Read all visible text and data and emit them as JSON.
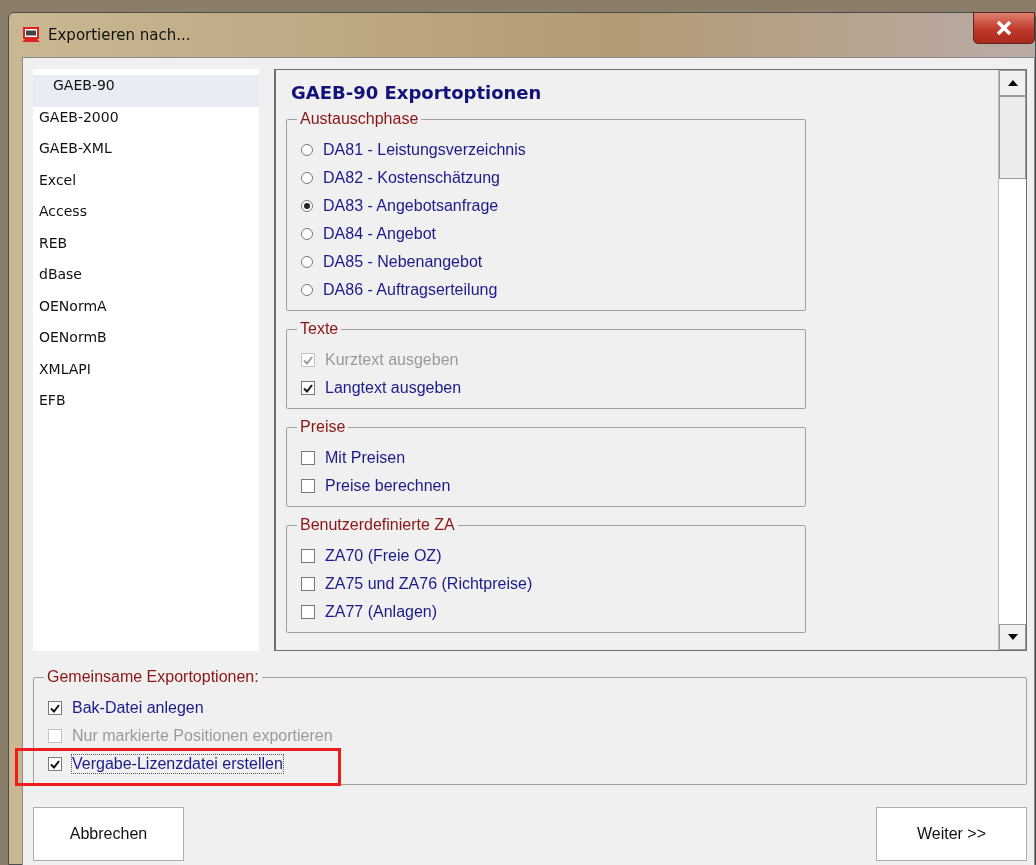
{
  "window": {
    "title": "Exportieren nach..."
  },
  "formats": [
    {
      "label": "GAEB-90",
      "selected": true
    },
    {
      "label": "GAEB-2000",
      "selected": false
    },
    {
      "label": "GAEB-XML",
      "selected": false
    },
    {
      "label": "Excel",
      "selected": false
    },
    {
      "label": "Access",
      "selected": false
    },
    {
      "label": "REB",
      "selected": false
    },
    {
      "label": "dBase",
      "selected": false
    },
    {
      "label": "OENormA",
      "selected": false
    },
    {
      "label": "OENormB",
      "selected": false
    },
    {
      "label": "XMLAPI",
      "selected": false
    },
    {
      "label": "EFB",
      "selected": false
    }
  ],
  "options_panel": {
    "heading": "GAEB-90 Exportoptionen",
    "groups": [
      {
        "title": "Austauschphase",
        "options": [
          {
            "kind": "radio",
            "label": "DA81 - Leistungsverzeichnis",
            "selected": false,
            "disabled": false
          },
          {
            "kind": "radio",
            "label": "DA82 - Kostenschätzung",
            "selected": false,
            "disabled": false
          },
          {
            "kind": "radio",
            "label": "DA83 - Angebotsanfrage",
            "selected": true,
            "disabled": false
          },
          {
            "kind": "radio",
            "label": "DA84 - Angebot",
            "selected": false,
            "disabled": false
          },
          {
            "kind": "radio",
            "label": "DA85 - Nebenangebot",
            "selected": false,
            "disabled": false
          },
          {
            "kind": "radio",
            "label": "DA86 - Auftragserteilung",
            "selected": false,
            "disabled": false
          }
        ]
      },
      {
        "title": "Texte",
        "options": [
          {
            "kind": "checkbox",
            "label": "Kurztext ausgeben",
            "checked": true,
            "disabled": true
          },
          {
            "kind": "checkbox",
            "label": "Langtext ausgeben",
            "checked": true,
            "disabled": false
          }
        ]
      },
      {
        "title": "Preise",
        "options": [
          {
            "kind": "checkbox",
            "label": "Mit Preisen",
            "checked": false,
            "disabled": false
          },
          {
            "kind": "checkbox",
            "label": "Preise berechnen",
            "checked": false,
            "disabled": false
          }
        ]
      },
      {
        "title": "Benutzerdefinierte ZA",
        "options": [
          {
            "kind": "checkbox",
            "label": "ZA70 (Freie OZ)",
            "checked": false,
            "disabled": false
          },
          {
            "kind": "checkbox",
            "label": "ZA75 und ZA76 (Richtpreise)",
            "checked": false,
            "disabled": false
          },
          {
            "kind": "checkbox",
            "label": "ZA77 (Anlagen)",
            "checked": false,
            "disabled": false
          }
        ]
      }
    ]
  },
  "common_options": {
    "title": "Gemeinsame Exportoptionen:",
    "options": [
      {
        "kind": "checkbox",
        "label": "Bak-Datei anlegen",
        "checked": true,
        "disabled": false
      },
      {
        "kind": "checkbox",
        "label": "Nur markierte Positionen exportieren",
        "checked": false,
        "disabled": true
      },
      {
        "kind": "checkbox",
        "label": "Vergabe-Lizenzdatei erstellen",
        "checked": true,
        "disabled": false
      }
    ]
  },
  "buttons": [
    {
      "label": "Abbrechen"
    },
    {
      "label": "Weiter >>"
    }
  ]
}
